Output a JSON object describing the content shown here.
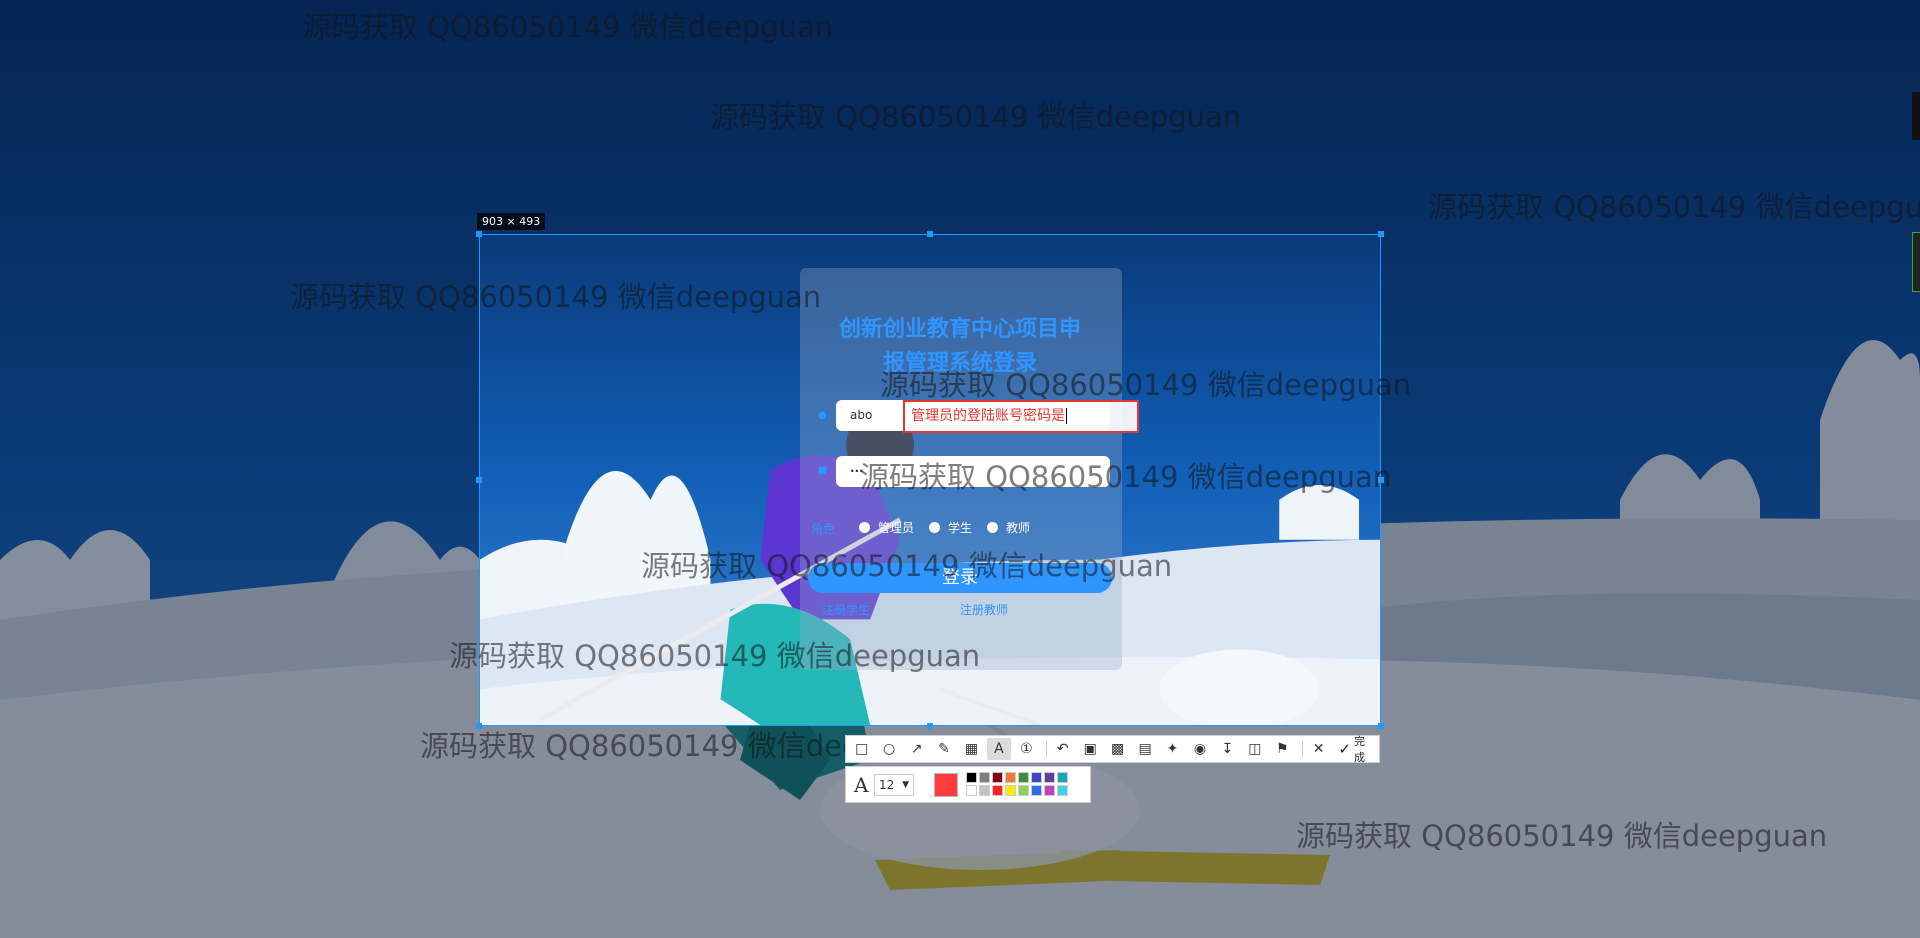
{
  "selection": {
    "size_label": "903 × 493"
  },
  "login": {
    "title_line1": "创新创业教育中心项目申",
    "title_line2": "报管理系统登录",
    "username_value": "abo",
    "password_value": "···",
    "role_label": "角色",
    "roles": [
      "管理员",
      "学生",
      "教师"
    ],
    "login_button": "登录",
    "register_student": "注册学生",
    "register_teacher": "注册教师"
  },
  "annotation": {
    "text": "管理员的登陆账号密码是"
  },
  "toolbar": {
    "icons": [
      "rectangle-icon",
      "ellipse-icon",
      "arrow-icon",
      "pen-icon",
      "mosaic-icon",
      "text-icon",
      "serial-number-icon",
      "undo-icon",
      "ocr-icon",
      "translate-icon",
      "long-screenshot-icon",
      "record-icon",
      "pin-icon",
      "download-icon",
      "save-icon",
      "bookmark-icon",
      "close-icon"
    ],
    "done_label": "完成"
  },
  "text_options": {
    "font_size": "12",
    "current_color": "#ff3b3b",
    "palette": [
      "#000000",
      "#7f7f7f",
      "#880015",
      "#ed7a39",
      "#3a8f3a",
      "#3f48cc",
      "#5e3fa1",
      "#18a5b4",
      "#ffffff",
      "#c3c3c3",
      "#ff2020",
      "#ffea00",
      "#8fd14f",
      "#2b6cf0",
      "#c040c0",
      "#40d0e0"
    ]
  },
  "watermark": {
    "text": "源码获取 QQ86050149 微信deepguan"
  }
}
